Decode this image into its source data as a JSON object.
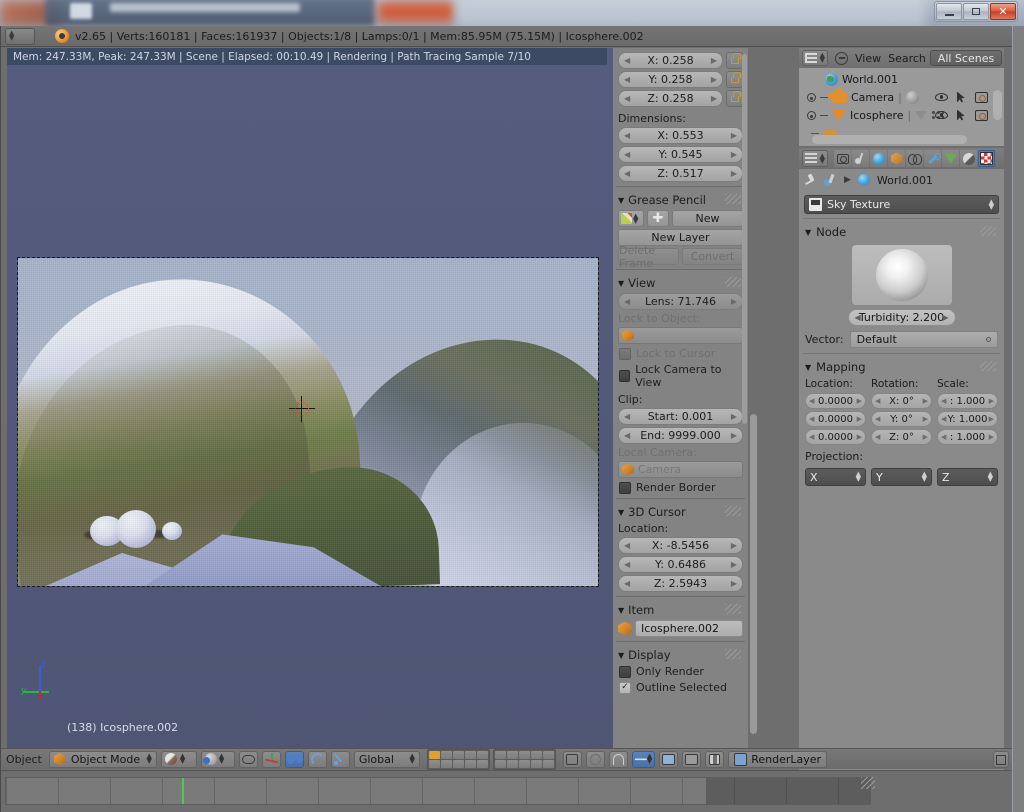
{
  "window": {
    "buttons": {
      "minimize": "minimize",
      "maximize": "maximize",
      "close": "close"
    }
  },
  "info_header": {
    "status": "v2.65 | Verts:160181 | Faces:161937 | Objects:1/8 | Lamps:0/1 | Mem:85.95M (75.15M) | Icosphere.002",
    "editor_type_icon": "editor-type-icon"
  },
  "render_status": {
    "text": "Mem: 247.33M, Peak: 247.33M | Scene | Elapsed: 00:10.49 | Rendering | Path Tracing Sample 7/10"
  },
  "viewport": {
    "object_label": "(138) Icosphere.002",
    "axis_z": "z",
    "axis_y": "y"
  },
  "npanel": {
    "scale": {
      "x": "X: 0.258",
      "y": "Y: 0.258",
      "z": "Z: 0.258"
    },
    "dimensions_label": "Dimensions:",
    "dimensions": {
      "x": "X: 0.553",
      "y": "Y: 0.545",
      "z": "Z: 0.517"
    },
    "grease_pencil": {
      "title": "Grease Pencil",
      "new": "New",
      "new_layer": "New Layer",
      "delete_frame": "Delete Frame",
      "convert": "Convert"
    },
    "view": {
      "title": "View",
      "lens": "Lens: 71.746",
      "lock_to_object_label": "Lock to Object:",
      "lock_to_object_value": "",
      "lock_to_cursor": "Lock to Cursor",
      "lock_camera_to_view": "Lock Camera to View",
      "clip_label": "Clip:",
      "clip_start": "Start: 0.001",
      "clip_end": "End: 9999.000",
      "local_camera_label": "Local Camera:",
      "local_camera_value": "Camera",
      "render_border": "Render Border"
    },
    "cursor3d": {
      "title": "3D Cursor",
      "location_label": "Location:",
      "x": "X: -8.5456",
      "y": "Y: 0.6486",
      "z": "Z: 2.5943"
    },
    "item": {
      "title": "Item",
      "name": "Icosphere.002"
    },
    "display": {
      "title": "Display",
      "only_render": "Only Render",
      "outline_selected": "Outline Selected"
    }
  },
  "outliner": {
    "menus": [
      "View",
      "Search"
    ],
    "scene_filter": "All Scenes",
    "rows": [
      {
        "name": "World.001",
        "icon": "world-icon",
        "indent": 2,
        "has_expand": false,
        "extras": []
      },
      {
        "name": "Camera",
        "icon": "camera-icon",
        "indent": 1,
        "has_expand": true,
        "extras": [
          "material-sphere-icon"
        ]
      },
      {
        "name": "Icosphere",
        "icon": "mesh-triangle-icon",
        "indent": 1,
        "has_expand": true,
        "extras": [
          "mesh-data-icon",
          "vertex-group-icon"
        ]
      }
    ],
    "row_toggles": [
      "eye-icon",
      "cursor-arrow-icon",
      "camera-render-icon"
    ]
  },
  "properties": {
    "tabs": [
      "render-tab",
      "scene-tab",
      "world-tab",
      "object-tab",
      "constraints-tab",
      "modifiers-tab",
      "data-tab",
      "material-tab",
      "texture-tab"
    ],
    "active_tab": "texture-tab",
    "breadcrumb": "World.001",
    "datablock": "Sky Texture",
    "node": {
      "title": "Node",
      "turbidity": "Turbidity: 2.200",
      "vector_label": "Vector:",
      "vector_value": "Default"
    },
    "mapping": {
      "title": "Mapping",
      "location_label": "Location:",
      "rotation_label": "Rotation:",
      "scale_label": "Scale:",
      "location": [
        "0.0000",
        "0.0000",
        "0.0000"
      ],
      "rotation": [
        "X: 0°",
        "Y: 0°",
        "Z: 0°"
      ],
      "scale": [
        ": 1.000",
        "Y: 1.000",
        ": 1.000"
      ],
      "projection_label": "Projection:",
      "projection": [
        "X",
        "Y",
        "Z"
      ]
    }
  },
  "view_header": {
    "menu": "Object",
    "mode": "Object Mode",
    "orientation": "Global",
    "render_layer": "RenderLayer"
  }
}
